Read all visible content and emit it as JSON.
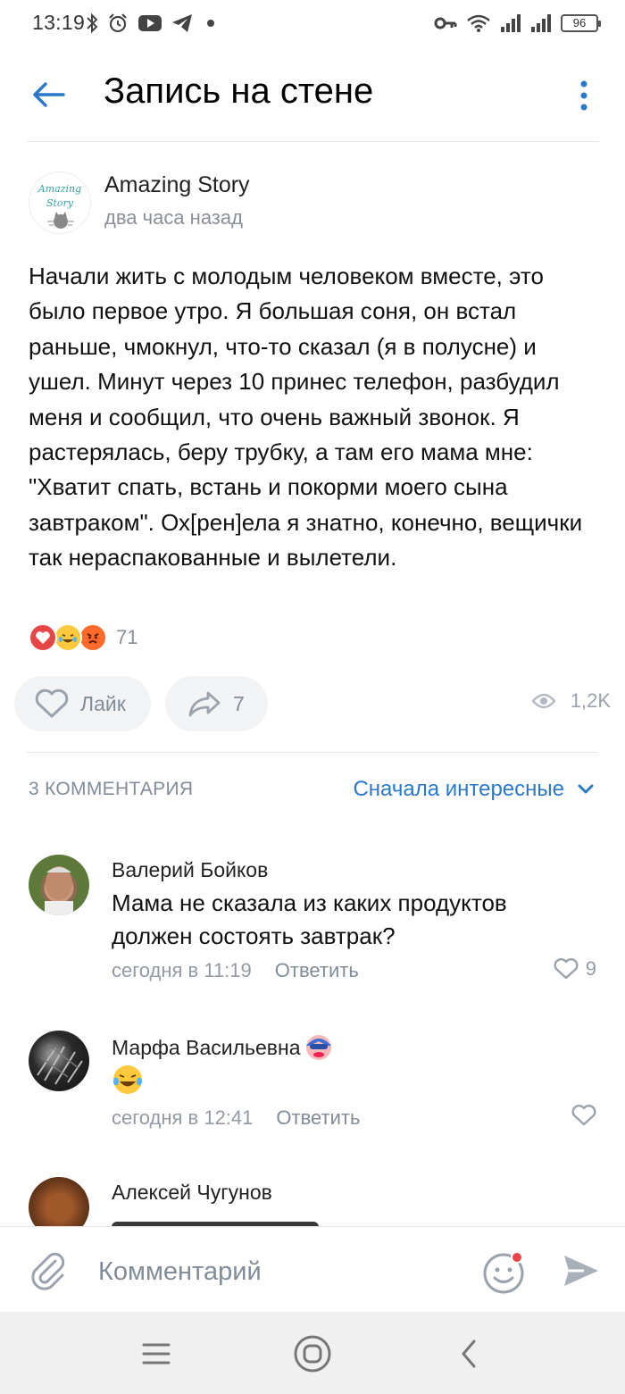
{
  "status_bar": {
    "time": "13:19",
    "battery": "96",
    "left_icons": [
      "bluetooth-icon",
      "alarm-icon",
      "youtube-icon",
      "telegram-icon",
      "dot-icon"
    ],
    "right_icons": [
      "key-icon",
      "wifi-icon",
      "signal-icon",
      "signal-hd-icon",
      "battery-icon"
    ]
  },
  "header": {
    "title": "Запись на стене",
    "back_icon": "arrow-left-icon",
    "more_icon": "more-vertical-icon"
  },
  "post": {
    "author": "Amazing Story",
    "avatar_text_1": "Amazing",
    "avatar_text_2": "Story",
    "time": "два часа назад",
    "text": "Начали жить с молодым человеком вместе, это было первое утро. Я большая соня, он встал раньше, чмокнул, что-то сказал (я в полусне) и ушел. Минут через 10 принес телефон, разбудил меня и сообщил, что очень важный звонок. Я растерялась, беру трубку, а там его мама мне: \"Хватит спать, встань и покорми моего сына завтраком\". Ох[рен]ела я знатно, конечно, вещички так нераспакованные и вылетели.",
    "reactions": [
      "heart-reaction",
      "laugh-reaction",
      "angry-reaction"
    ],
    "reactions_count": "71",
    "like_label": "Лайк",
    "share_count": "7",
    "views": "1,2K"
  },
  "comments_section": {
    "count_label": "3 КОММЕНТАРИЯ",
    "sort_label": "Сначала интересные",
    "items": [
      {
        "author": "Валерий Бойков",
        "text": "Мама не сказала из каких продуктов должен состоять завтрак?",
        "time": "сегодня в 11:19",
        "reply": "Ответить",
        "likes": "9"
      },
      {
        "author": "Марфа Васильевна",
        "text": "😂",
        "time": "сегодня в 12:41",
        "reply": "Ответить",
        "likes": ""
      },
      {
        "author": "Алексей Чугунов"
      }
    ]
  },
  "input_bar": {
    "placeholder": "Комментарий"
  },
  "colors": {
    "accent": "#2a78c9",
    "secondary_text": "#818c99",
    "button_bg": "#f2f3f5",
    "heart_red": "#e64646"
  }
}
